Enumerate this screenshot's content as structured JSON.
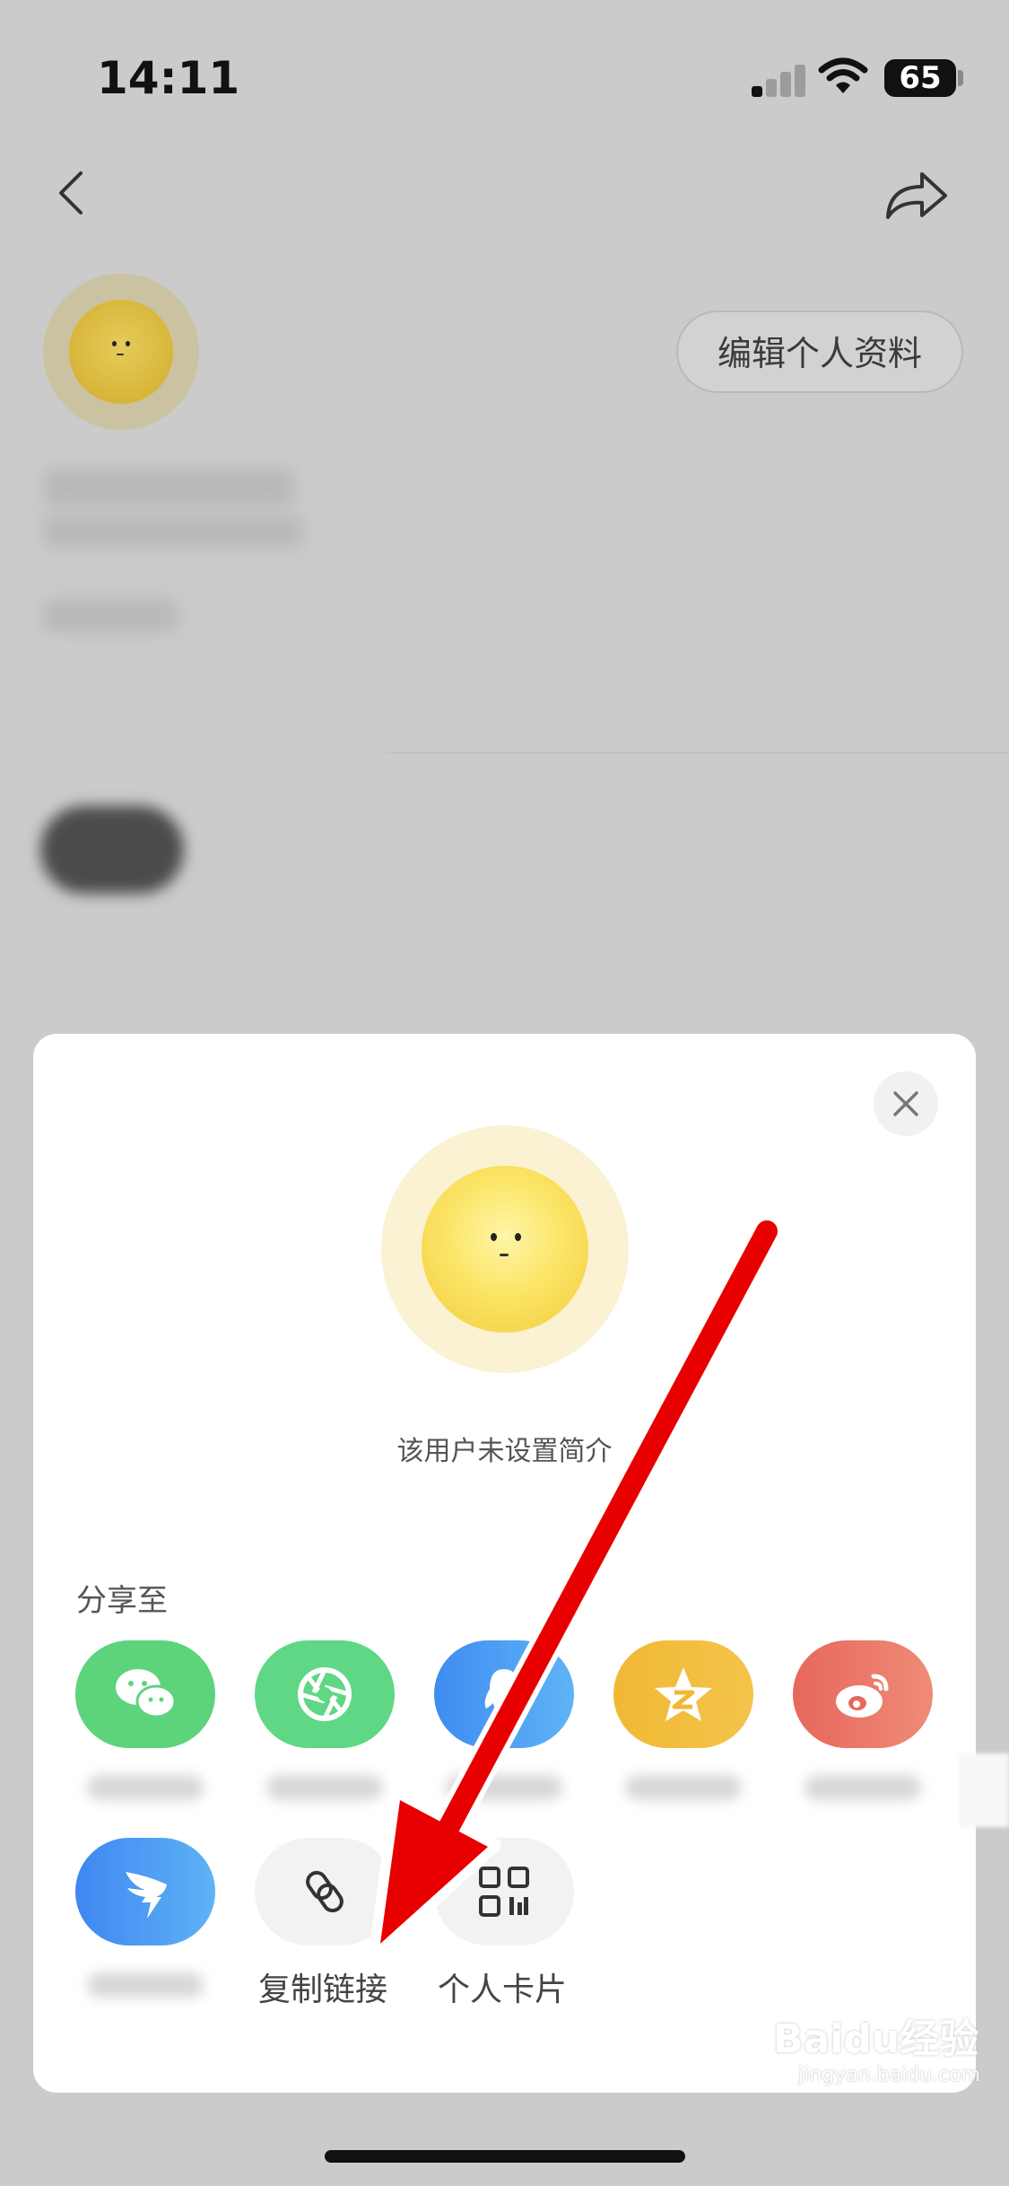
{
  "status_bar": {
    "time": "14:11",
    "battery": "65"
  },
  "profile": {
    "edit_button_label": "编辑个人资料"
  },
  "share_sheet": {
    "intro_text": "该用户未设置简介",
    "share_to_label": "分享至",
    "apps": [
      {
        "icon": "wechat-icon",
        "color": "#5dd37c"
      },
      {
        "icon": "moments-icon",
        "color": "#5fd784"
      },
      {
        "icon": "qq-icon",
        "color": "#4c9cf3"
      },
      {
        "icon": "qzone-icon",
        "color": "#f1b834"
      },
      {
        "icon": "weibo-icon",
        "color": "#ec7568"
      },
      {
        "icon": "dingtalk-icon",
        "color": "#4b8ef3"
      }
    ],
    "actions": [
      {
        "icon": "link-icon",
        "label": "复制链接"
      },
      {
        "icon": "qr-code-icon",
        "label": "个人卡片"
      }
    ]
  },
  "watermark": {
    "text": "Baidu经验",
    "url": "jingyan.baidu.com"
  },
  "colors": {
    "overlay": "#cbcbcb",
    "sheet": "#ffffff",
    "arrow": "#e80000"
  }
}
